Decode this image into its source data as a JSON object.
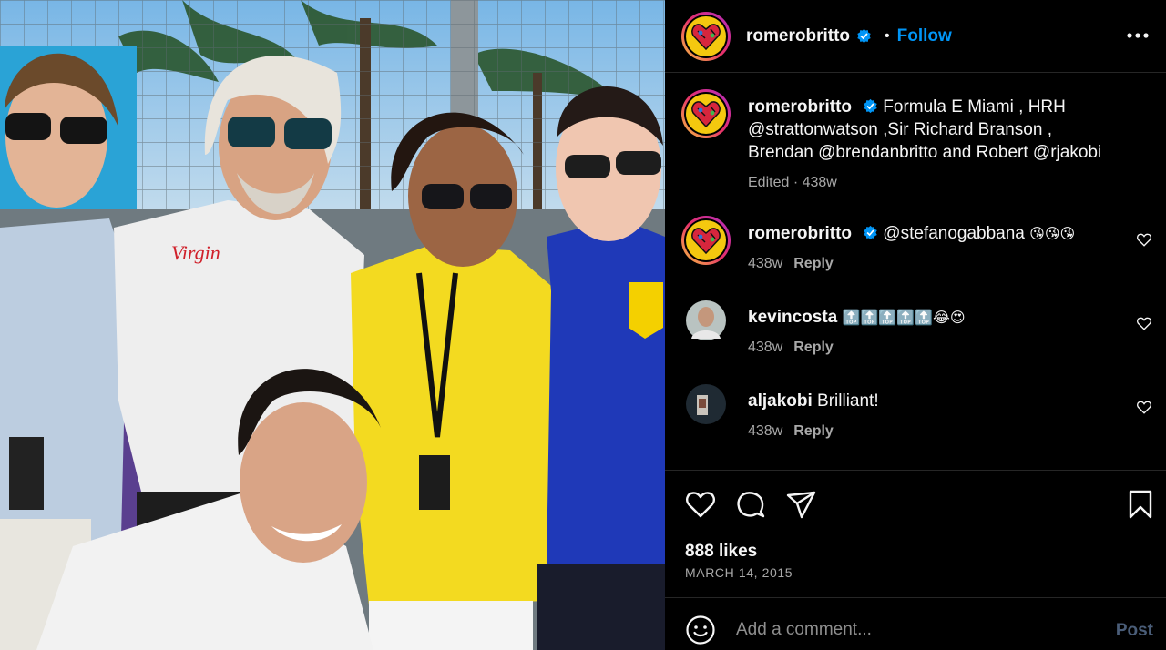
{
  "post": {
    "username": "romerobritto",
    "follow_label": "Follow",
    "dot": "•",
    "caption": {
      "username": "romerobritto",
      "text": "Formula E Miami , HRH @strattonwatson ,Sir Richard Branson , Brendan @brendanbritto and Robert @rjakobi",
      "meta": "Edited · 438w"
    },
    "comments": [
      {
        "username": "romerobritto",
        "text": "@stefanogabbana",
        "emoji": "😘😘😘",
        "age": "438w",
        "reply": "Reply"
      },
      {
        "username": "kevincosta",
        "text": "",
        "emoji": "🔝🔝🔝🔝🔝😂😍",
        "age": "438w",
        "reply": "Reply"
      },
      {
        "username": "aljakobi",
        "text": "Brilliant!",
        "emoji": "",
        "age": "438w",
        "reply": "Reply"
      }
    ],
    "likes": "888 likes",
    "date": "MARCH 14, 2015",
    "comment_placeholder": "Add a comment...",
    "post_label": "Post"
  },
  "icons": {
    "verified": "verified-badge-icon",
    "more": "more-options-icon",
    "like": "heart-icon",
    "comment": "comment-icon",
    "share": "share-icon",
    "save": "bookmark-icon",
    "emoji": "emoji-icon"
  },
  "colors": {
    "accent": "#0095f6",
    "background": "#000000",
    "muted": "#a8a8a8",
    "post_disabled": "#4a5d78"
  },
  "photo_text": {
    "shirt_logo": "Virgin"
  }
}
